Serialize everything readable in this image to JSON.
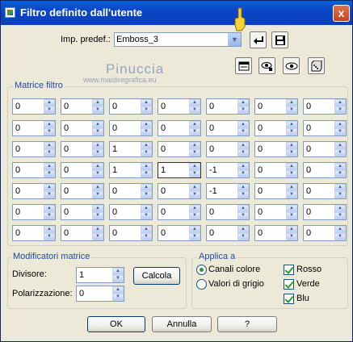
{
  "window": {
    "title": "Filtro definito dall'utente",
    "close_label": "x"
  },
  "preset": {
    "label": "Imp. predef.:",
    "value": "Emboss_3"
  },
  "watermark": {
    "name": "Pinuccia",
    "url": "www.maidiregrafica.eu"
  },
  "matrix": {
    "legend": "Matrice filtro",
    "rows": [
      [
        "0",
        "0",
        "0",
        "0",
        "0",
        "0",
        "0"
      ],
      [
        "0",
        "0",
        "0",
        "0",
        "0",
        "0",
        "0"
      ],
      [
        "0",
        "0",
        "1",
        "0",
        "0",
        "0",
        "0"
      ],
      [
        "0",
        "0",
        "1",
        "1",
        "-1",
        "0",
        "0"
      ],
      [
        "0",
        "0",
        "0",
        "0",
        "-1",
        "0",
        "0"
      ],
      [
        "0",
        "0",
        "0",
        "0",
        "0",
        "0",
        "0"
      ],
      [
        "0",
        "0",
        "0",
        "0",
        "0",
        "0",
        "0"
      ]
    ]
  },
  "modifiers": {
    "legend": "Modificatori matrice",
    "divisor_label": "Divisore:",
    "divisor_value": "1",
    "bias_label": "Polarizzazione:",
    "bias_value": "0",
    "calc_label": "Calcola"
  },
  "apply": {
    "legend": "Applica a",
    "color_channels_label": "Canali colore",
    "grayscale_label": "Valori di grigio",
    "red_label": "Rosso",
    "green_label": "Verde",
    "blue_label": "Blu"
  },
  "footer": {
    "ok_label": "OK",
    "cancel_label": "Annulla",
    "help_label": "?"
  }
}
